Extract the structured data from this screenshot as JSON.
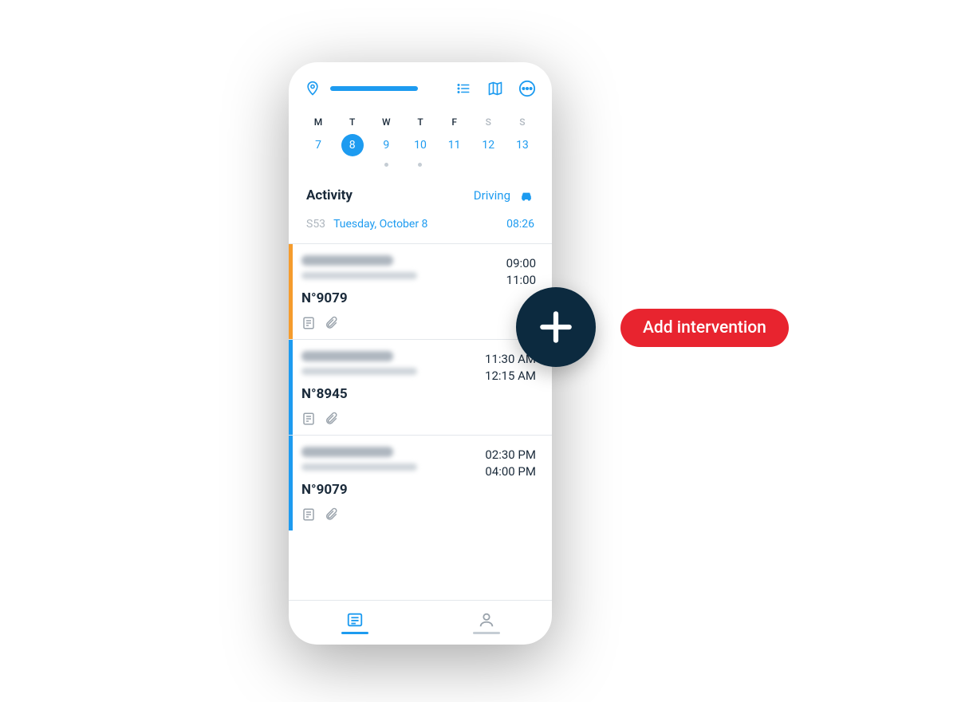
{
  "header": {
    "icons": {
      "location": "location-pin-icon",
      "list": "list-icon",
      "map": "map-icon",
      "more": "more-icon"
    }
  },
  "week": [
    {
      "label": "M",
      "num": "7",
      "selected": false,
      "weekend": false,
      "dot": false
    },
    {
      "label": "T",
      "num": "8",
      "selected": true,
      "weekend": false,
      "dot": false
    },
    {
      "label": "W",
      "num": "9",
      "selected": false,
      "weekend": false,
      "dot": true
    },
    {
      "label": "T",
      "num": "10",
      "selected": false,
      "weekend": false,
      "dot": true
    },
    {
      "label": "F",
      "num": "11",
      "selected": false,
      "weekend": false,
      "dot": false
    },
    {
      "label": "S",
      "num": "12",
      "selected": false,
      "weekend": true,
      "dot": false
    },
    {
      "label": "S",
      "num": "13",
      "selected": false,
      "weekend": true,
      "dot": false
    }
  ],
  "activity": {
    "title": "Activity",
    "status_label": "Driving"
  },
  "date": {
    "week": "S53",
    "full": "Tuesday, October 8",
    "time": "08:26"
  },
  "cards": [
    {
      "stripe": "orange",
      "ref": "N°9079",
      "t1": "09:00",
      "t2": "11:00"
    },
    {
      "stripe": "blue",
      "ref": "N°8945",
      "t1": "11:30 AM",
      "t2": "12:15 AM"
    },
    {
      "stripe": "blue",
      "ref": "N°9079",
      "t1": "02:30 PM",
      "t2": "04:00 PM"
    }
  ],
  "fab": {
    "label": "Add intervention"
  },
  "colors": {
    "accent": "#1D9BF0",
    "fab": "#0c2a3f",
    "pill": "#E8242F",
    "orange": "#F59C2D"
  }
}
